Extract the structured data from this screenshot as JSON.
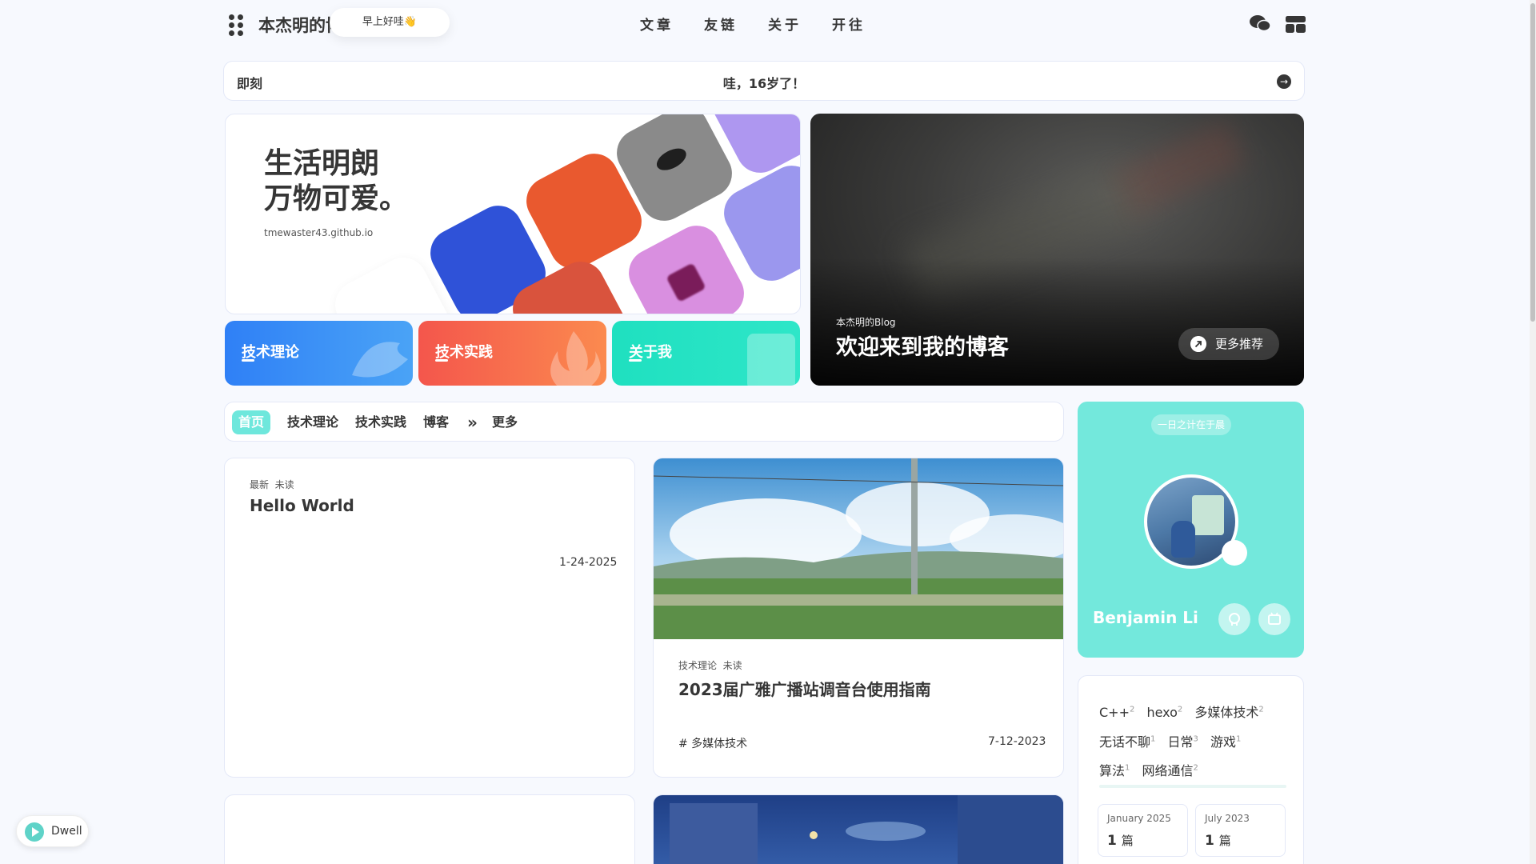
{
  "nav": {
    "site_title": "本杰明的博客",
    "greeting": "早上好哇👋",
    "links": [
      "文章",
      "友链",
      "关于",
      "开往"
    ],
    "menu_icon": "grid-dots-icon",
    "wechat_icon": "wechat-icon",
    "layout_icon": "layout-icon"
  },
  "announcement": {
    "label": "即刻",
    "text": "哇，16岁了！",
    "arrow": "→"
  },
  "hero": {
    "slogan_line1": "生活明朗",
    "slogan_line2": "万物可爱。",
    "url": "tmewaster43.github.io"
  },
  "categories": [
    {
      "label": "技术理论",
      "color": "#3a82f7"
    },
    {
      "label": "技术实践",
      "color": "#f56b4e"
    },
    {
      "label": "关于我",
      "color": "#23dcb8"
    }
  ],
  "feature": {
    "subtitle": "本杰明的Blog",
    "title": "欢迎来到我的博客",
    "more_label": "更多推荐"
  },
  "tabs": {
    "items": [
      "首页",
      "技术理论",
      "技术实践",
      "博客"
    ],
    "more_icon": "»",
    "more_label": "更多"
  },
  "posts": [
    {
      "meta": "最新  未读",
      "title": "Hello World",
      "date": "1-24-2025"
    },
    {
      "meta": "技术理论  未读",
      "title": "2023届广雅广播站调音台使用指南",
      "tag": "# 多媒体技术",
      "date": "7-12-2023"
    }
  ],
  "profile": {
    "motto": "一日之计在于晨",
    "name": "Benjamin Li",
    "social": [
      "github-icon",
      "bilibili-icon"
    ]
  },
  "tags": [
    {
      "name": "C++",
      "count": "2"
    },
    {
      "name": "hexo",
      "count": "2"
    },
    {
      "name": "多媒体技术",
      "count": "2"
    },
    {
      "name": "无话不聊",
      "count": "1"
    },
    {
      "name": "日常",
      "count": "3"
    },
    {
      "name": "游戏",
      "count": "1"
    },
    {
      "name": "算法",
      "count": "1"
    },
    {
      "name": "网络通信",
      "count": "2"
    }
  ],
  "archives": [
    {
      "month": "January 2025",
      "count": "1",
      "unit": "篇"
    },
    {
      "month": "July 2023",
      "count": "1",
      "unit": "篇"
    }
  ],
  "dwell": {
    "label": "Dwell"
  },
  "colors": {
    "accent": "#6ee7dc",
    "profile_bg": "#73e8dc",
    "text": "#363636"
  }
}
